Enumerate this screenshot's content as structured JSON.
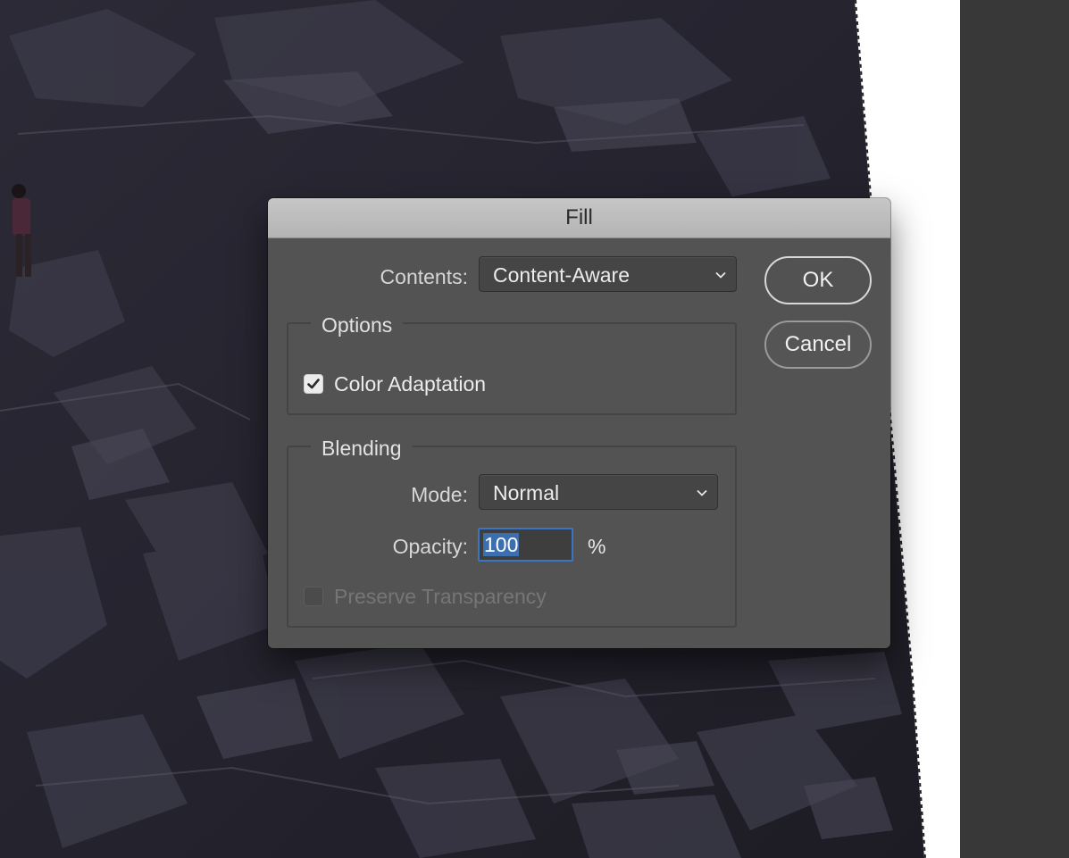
{
  "dialog": {
    "title": "Fill",
    "contents": {
      "label": "Contents:",
      "value": "Content-Aware"
    },
    "options": {
      "legend": "Options",
      "color_adaptation": {
        "label": "Color Adaptation",
        "checked": true
      }
    },
    "blending": {
      "legend": "Blending",
      "mode": {
        "label": "Mode:",
        "value": "Normal"
      },
      "opacity": {
        "label": "Opacity:",
        "value": "100",
        "unit": "%"
      },
      "preserve_transparency": {
        "label": "Preserve Transparency",
        "checked": false,
        "enabled": false
      }
    },
    "buttons": {
      "ok": "OK",
      "cancel": "Cancel"
    }
  },
  "icons": {
    "chevron": "chevron-down-icon",
    "check": "checkmark-icon"
  },
  "colors": {
    "dialog_bg": "#535353",
    "titlebar": "#bdbdbd",
    "focus_ring": "#3b76c4",
    "canvas_white": "#ffffff",
    "workspace": "#383838"
  }
}
